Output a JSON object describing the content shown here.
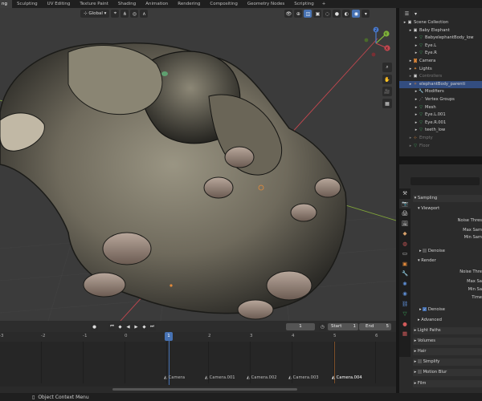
{
  "tabs": [
    "Sculpting",
    "UV Editing",
    "Texture Paint",
    "Shading",
    "Animation",
    "Rendering",
    "Compositing",
    "Geometry Nodes",
    "Scripting",
    "+"
  ],
  "viewport": {
    "orientation": "Global",
    "gizmo_axes": [
      "Y",
      "X",
      "Z"
    ]
  },
  "outliner": {
    "rows": [
      {
        "label": "Scene Collection",
        "indent": 0,
        "icon": "collection-icon"
      },
      {
        "label": "Baby Elephant",
        "indent": 1,
        "icon": "collection-icon"
      },
      {
        "label": "BabyelephantBody_low",
        "indent": 2,
        "icon": "mesh-icon"
      },
      {
        "label": "Eye.L",
        "indent": 2,
        "icon": "mesh-icon"
      },
      {
        "label": "Eye.R",
        "indent": 2,
        "icon": "mesh-icon"
      },
      {
        "label": "Camera",
        "indent": 1,
        "icon": "camera-icon"
      },
      {
        "label": "Lights",
        "indent": 1,
        "icon": "light-icon"
      },
      {
        "label": "Controllers",
        "indent": 1,
        "icon": "collection-icon",
        "dim": true
      },
      {
        "label": "elephantBody_parenti",
        "indent": 1,
        "icon": "armature-icon",
        "selected": true
      },
      {
        "label": "Modifiers",
        "indent": 2,
        "icon": "wrench-icon"
      },
      {
        "label": "Vertex Groups",
        "indent": 2,
        "icon": "vertex-group-icon"
      },
      {
        "label": "Mesh",
        "indent": 2,
        "icon": "mesh-icon"
      },
      {
        "label": "Eye.L.001",
        "indent": 2,
        "icon": "mesh-icon"
      },
      {
        "label": "Eye.R.001",
        "indent": 2,
        "icon": "mesh-icon"
      },
      {
        "label": "teeth_low",
        "indent": 2,
        "icon": "mesh-icon"
      },
      {
        "label": "Empty",
        "indent": 1,
        "icon": "empty-icon",
        "dim": true
      },
      {
        "label": "Floor",
        "indent": 1,
        "icon": "mesh-icon",
        "dim": true
      }
    ]
  },
  "properties": {
    "sampling": "Sampling",
    "viewport": "Viewport",
    "noise_threshold": "Noise Thres",
    "max_samples": "Max Sam",
    "min_samples": "Min Sam",
    "denoise": "Denoise",
    "render": "Render",
    "r_noise_threshold": "Noise Thre",
    "r_max_samples": "Max Sa",
    "r_min_samples": "Min Sa",
    "time_limit": "Time",
    "r_denoise": "Denoise",
    "advanced": "Advanced",
    "light_paths": "Light Paths",
    "volumes": "Volumes",
    "hair": "Hair",
    "simplify": "Simplify",
    "motion_blur": "Motion Blur",
    "film": "Film"
  },
  "timeline": {
    "current_frame": "1",
    "start_label": "Start",
    "start_value": "1",
    "end_label": "End",
    "end_value": "5",
    "ruler": [
      "-3",
      "-2",
      "-1",
      "0",
      "1",
      "2",
      "3",
      "4",
      "5",
      "6"
    ],
    "markers": [
      "Camera",
      "Camera.001",
      "Camera.002",
      "Camera.003",
      "Camera.004"
    ]
  },
  "status": {
    "context_menu": "Object Context Menu"
  }
}
